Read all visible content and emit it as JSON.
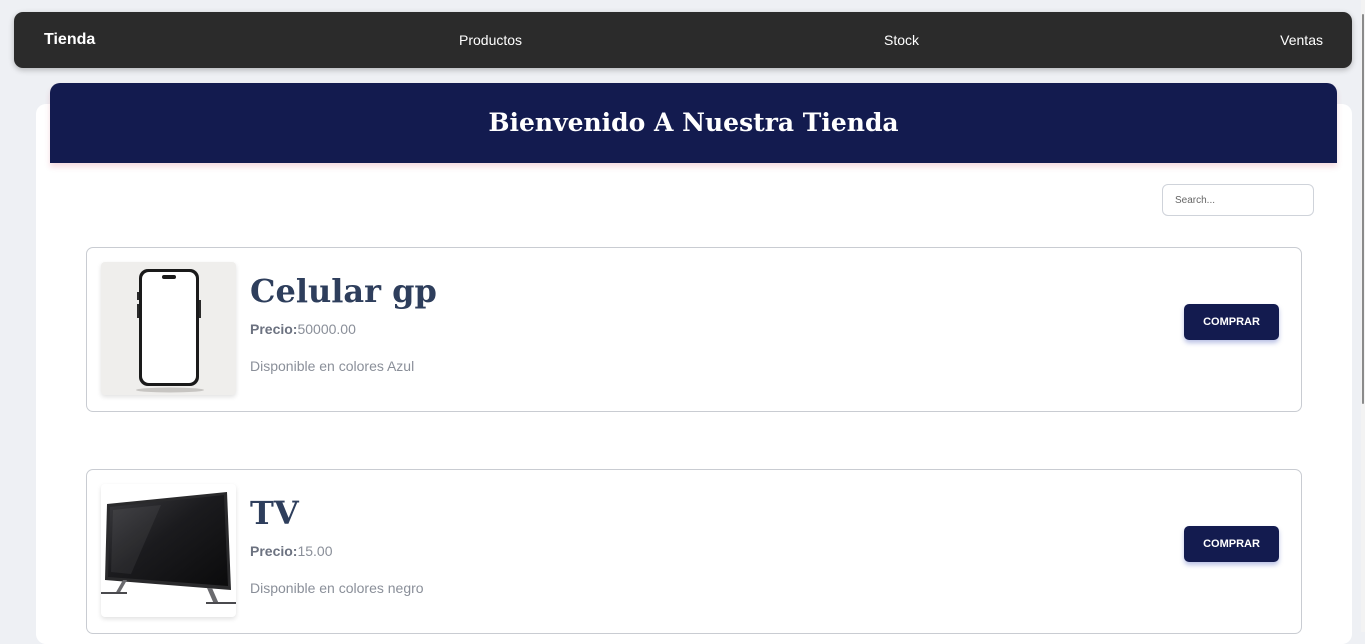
{
  "navbar": {
    "brand": "Tienda",
    "links": [
      "Productos",
      "Stock",
      "Ventas"
    ]
  },
  "hero": {
    "title": "Bienvenido A Nuestra Tienda"
  },
  "search": {
    "placeholder": "Search..."
  },
  "products": [
    {
      "name": "Celular gp",
      "price_label": "Precio:",
      "price": "50000.00",
      "description": "Disponible en colores Azul",
      "button": "COMPRAR",
      "image": "smartphone-image"
    },
    {
      "name": "TV",
      "price_label": "Precio:",
      "price": "15.00",
      "description": "Disponible en colores negro",
      "button": "COMPRAR",
      "image": "television-image"
    }
  ],
  "colors": {
    "navbar": "#2b2b2b",
    "primary": "#131b4f",
    "product_title": "#2e3e5c"
  }
}
